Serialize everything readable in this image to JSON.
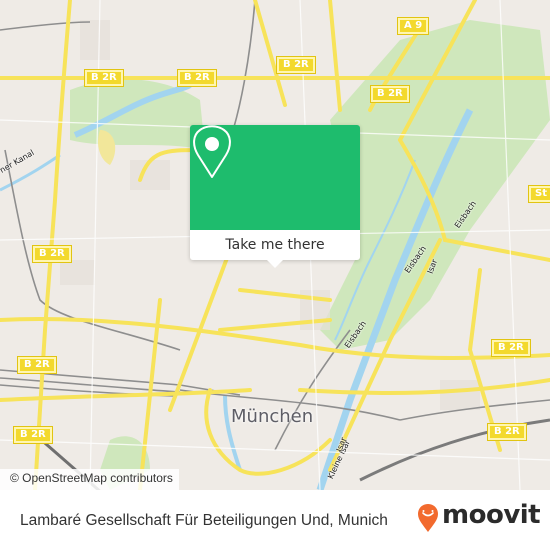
{
  "map": {
    "city_label": "München",
    "attribution": "© OpenStreetMap contributors",
    "road_labels": [
      {
        "text": "B 2R"
      },
      {
        "text": "B 2R"
      },
      {
        "text": "B 2R"
      },
      {
        "text": "B 2R"
      },
      {
        "text": "A 9"
      },
      {
        "text": "B 2R"
      },
      {
        "text": "B 2R"
      },
      {
        "text": "B 2R"
      },
      {
        "text": "B 2R"
      },
      {
        "text": "St"
      },
      {
        "text": "B 2R"
      }
    ],
    "street_labels": [
      {
        "text": "Eisbach"
      },
      {
        "text": "Eisbach"
      },
      {
        "text": "Isar"
      },
      {
        "text": "Eisbach"
      },
      {
        "text": "ner Kanal"
      },
      {
        "text": "Kleine Isar"
      },
      {
        "text": "Isar"
      }
    ],
    "colors": {
      "land": "#efebe6",
      "park": "#c8e6b0",
      "water": "#9fd2f0",
      "major_road": "#f7e35a",
      "rail": "#8a8a8a"
    }
  },
  "popup": {
    "icon": "map-pin-icon",
    "button_label": "Take me there",
    "color": "#1ebc6d"
  },
  "footer": {
    "title": "Lambaré Gesellschaft Für Beteiligungen Und, Munich",
    "brand": "moovit",
    "brand_icon": "moovit-pin-icon",
    "brand_color": "#f26a2e"
  }
}
